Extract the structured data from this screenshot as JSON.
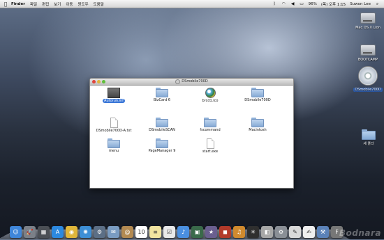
{
  "menubar": {
    "apple": "",
    "app_name": "Finder",
    "menus": [
      "파일",
      "편집",
      "보기",
      "이동",
      "윈도우",
      "도움말"
    ],
    "right": {
      "battery_pct": "96%",
      "clock": "(목) 오후 1:15",
      "user": "Suwon Lee"
    }
  },
  "desktop_icons": [
    {
      "label": "Mac OS X Lion",
      "icon": "hard-drive-icon"
    },
    {
      "label": "BOOTCAMP",
      "icon": "hard-drive-icon"
    },
    {
      "label": "DSmobile700D",
      "icon": "disc-icon"
    },
    {
      "label": "새 폴더",
      "icon": "folder-icon"
    }
  ],
  "window": {
    "title": "DSmobile700D",
    "items": [
      {
        "name": "Autorun.inf",
        "icon": "inf-file-icon",
        "selected": true
      },
      {
        "name": "BizCard 6",
        "icon": "folder-icon"
      },
      {
        "name": "brcd1.ico",
        "icon": "ico-file-icon"
      },
      {
        "name": "DSmobile700D",
        "icon": "folder-icon"
      },
      {
        "name": "DSmobile700D-A.txt",
        "icon": "document-icon"
      },
      {
        "name": "DSmobileSCAN",
        "icon": "folder-icon"
      },
      {
        "name": "fscommand",
        "icon": "folder-icon"
      },
      {
        "name": "Macintosh",
        "icon": "folder-icon"
      },
      {
        "name": "menu",
        "icon": "folder-icon"
      },
      {
        "name": "PageManager 9",
        "icon": "folder-icon"
      },
      {
        "name": "start.exe",
        "icon": "document-icon"
      }
    ]
  },
  "dock": {
    "items": [
      {
        "name": "finder",
        "color": "#3f86d9",
        "glyph": "☺"
      },
      {
        "name": "launchpad",
        "color": "#7b8088",
        "glyph": "🚀"
      },
      {
        "name": "mission-control",
        "color": "#4b4f55",
        "glyph": "▦"
      },
      {
        "name": "app-store",
        "color": "#2c89e0",
        "glyph": "A"
      },
      {
        "name": "chrome",
        "color": "#e0b63a",
        "glyph": "◉"
      },
      {
        "name": "safari",
        "color": "#3d8fd6",
        "glyph": "✺"
      },
      {
        "name": "system-utility",
        "color": "#5c6f86",
        "glyph": "⚙"
      },
      {
        "name": "mail",
        "color": "#7a9cc2",
        "glyph": "✉"
      },
      {
        "name": "address-book",
        "color": "#b38a52",
        "glyph": "@"
      },
      {
        "name": "calendar",
        "color": "#ffffff",
        "glyph": "10"
      },
      {
        "name": "notes",
        "color": "#f1e4a0",
        "glyph": "≡"
      },
      {
        "name": "reminders",
        "color": "#e9e9e9",
        "glyph": "☑"
      },
      {
        "name": "itunes",
        "color": "#4a8fe0",
        "glyph": "♪"
      },
      {
        "name": "iphoto",
        "color": "#3a6a4a",
        "glyph": "▣"
      },
      {
        "name": "imovie",
        "color": "#6a5f8f",
        "glyph": "★"
      },
      {
        "name": "photo-booth",
        "color": "#b23a2a",
        "glyph": "◼"
      },
      {
        "name": "garageband",
        "color": "#d08a2e",
        "glyph": "♫"
      },
      {
        "name": "aperture",
        "color": "#2f2f2f",
        "glyph": "✳"
      },
      {
        "name": "preview",
        "color": "#a7a7a7",
        "glyph": "◧"
      },
      {
        "name": "system-preferences",
        "color": "#8a8f96",
        "glyph": "⚙"
      },
      {
        "name": "script-editor",
        "color": "#d9d9d9",
        "glyph": "✎"
      },
      {
        "name": "textedit",
        "color": "#efefef",
        "glyph": "✍"
      },
      {
        "name": "utilities",
        "color": "#5b82b8",
        "glyph": "⚒"
      },
      {
        "name": "font-book",
        "color": "#777777",
        "glyph": "F"
      }
    ]
  },
  "watermark": "Bodnara"
}
